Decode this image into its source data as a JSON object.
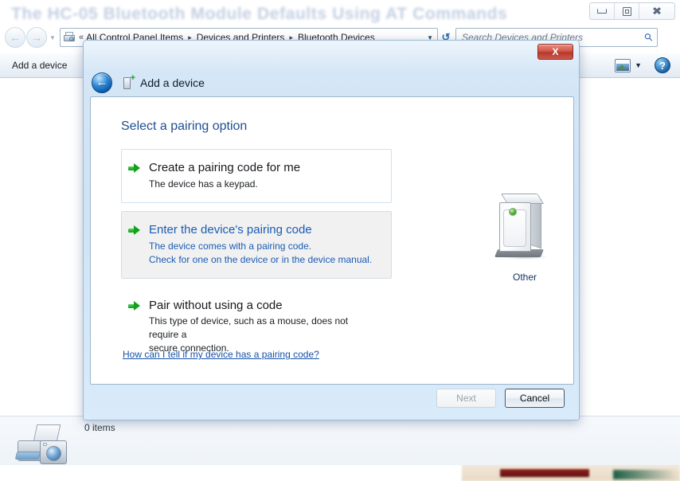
{
  "page": {
    "background_title": "The HC-05 Bluetooth Module Defaults Using AT Commands"
  },
  "window": {
    "controls": {
      "minimize": "Minimize",
      "maximize": "Maximize",
      "close": "Close"
    },
    "address": {
      "back_glyph": "←",
      "forward_glyph": "→",
      "history_glyph": "▼",
      "overflow_glyph": "«",
      "breadcrumbs": [
        "All Control Panel Items",
        "Devices and Printers",
        "Bluetooth Devices"
      ],
      "separator": "▸",
      "dropdown_glyph": "▼",
      "refresh_glyph": "↺"
    },
    "search": {
      "placeholder": "Search Devices and Printers",
      "value": "",
      "icon": "search-icon"
    },
    "toolbar": {
      "add_device_label": "Add a device",
      "view_icon": "view-icon",
      "view_caret": "▼",
      "help_label": "?"
    },
    "status": {
      "items_text": "0 items"
    }
  },
  "dialog": {
    "close_label": "X",
    "back_label": "←",
    "title": "Add a device",
    "heading": "Select a pairing option",
    "options": [
      {
        "title": "Create a pairing code for me",
        "lines": [
          "The device has a keypad."
        ],
        "state": "normal"
      },
      {
        "title": "Enter the device's pairing code",
        "lines": [
          "The device comes with a pairing code.",
          "Check for one on the device or in the device manual."
        ],
        "state": "hovered"
      },
      {
        "title": "Pair without using a code",
        "lines": [
          "This type of device, such as a mouse, does not require a",
          "secure connection."
        ],
        "state": "plain"
      }
    ],
    "help_link": "How can I tell if my device has a pairing code?",
    "device": {
      "label": "Other",
      "icon": "generic-device-icon"
    },
    "buttons": {
      "next": "Next",
      "cancel": "Cancel"
    }
  },
  "colors": {
    "heading_blue": "#1f4f91",
    "link_blue": "#1551a8",
    "hover_blue": "#1b5cb4",
    "arrow_green": "#12a01d",
    "close_red": "#c14a3c"
  }
}
